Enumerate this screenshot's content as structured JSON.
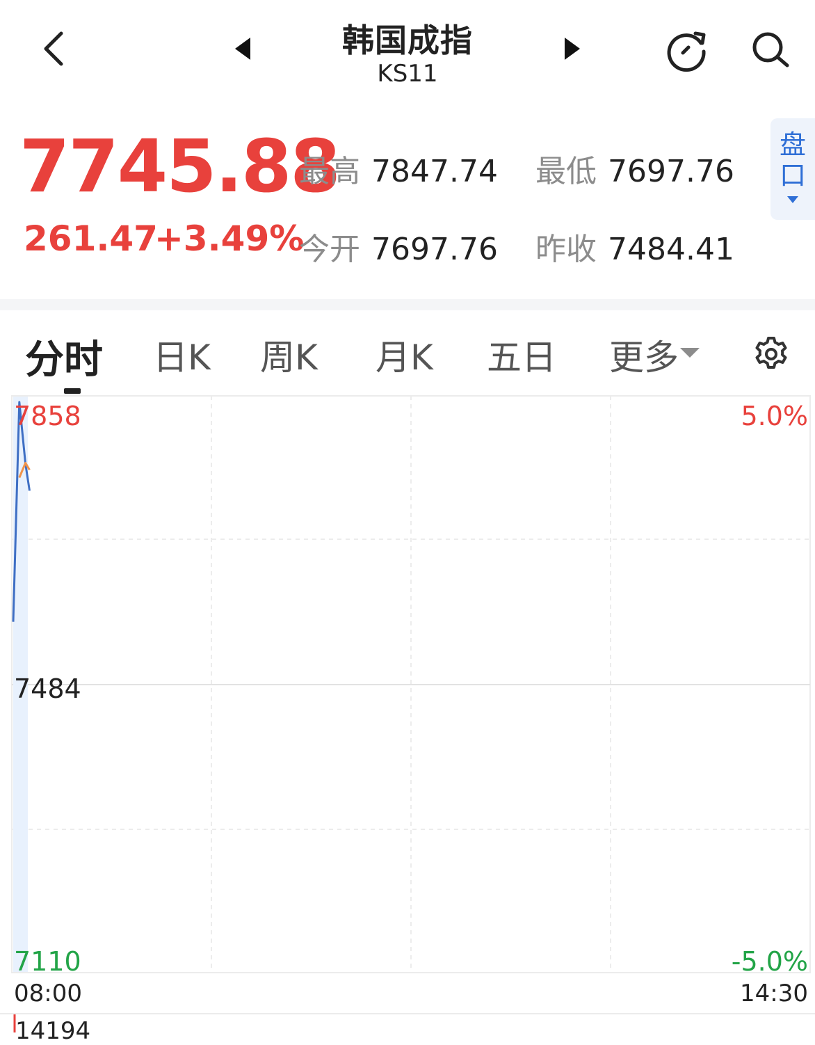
{
  "header": {
    "title": "韩国成指",
    "code": "KS11"
  },
  "quote": {
    "price": "7745.88",
    "change": "261.47",
    "change_pct": "+3.49%",
    "high_label": "最高",
    "high_value": "7847.74",
    "low_label": "最低",
    "low_value": "7697.76",
    "open_label": "今开",
    "open_value": "7697.76",
    "prev_close_label": "昨收",
    "prev_close_value": "7484.41",
    "pankou_label": "盘口"
  },
  "tabs": [
    {
      "label": "分时",
      "active": true
    },
    {
      "label": "日K"
    },
    {
      "label": "周K"
    },
    {
      "label": "月K"
    },
    {
      "label": "五日"
    },
    {
      "label": "更多"
    }
  ],
  "chart": {
    "y_top_label": "7858",
    "y_mid_label": "7484",
    "y_bottom_label": "7110",
    "pct_top_label": "5.0%",
    "pct_bottom_label": "-5.0%",
    "x_start_label": "08:00",
    "x_end_label": "14:30",
    "volume_label": "14194"
  },
  "chart_data": {
    "type": "line",
    "x_range": [
      "08:00",
      "14:30"
    ],
    "ylim": [
      7110,
      7858
    ],
    "y_ticks": [
      7110,
      7484,
      7858
    ],
    "pct_ticks": [
      "-5.0%",
      "5.0%"
    ],
    "grid": true,
    "series": [
      {
        "x": [
          "08:00",
          "08:03",
          "08:06",
          "08:08"
        ],
        "values": [
          7565,
          7850,
          7770,
          7735
        ],
        "color": "#3f6fc4"
      },
      {
        "x": [
          "08:03",
          "08:06",
          "08:08"
        ],
        "values": [
          7752,
          7771,
          7762
        ],
        "color": "#f0934a"
      }
    ]
  },
  "colors": {
    "up": "#e8413c",
    "down": "#22a447",
    "accent": "#2f6fd6",
    "price_line": "#3f6fc4",
    "avg_line": "#f0934a"
  },
  "icons": {
    "back": "chevron-left-icon",
    "prev": "triangle-left-icon",
    "next": "triangle-right-icon",
    "refresh": "refresh-icon",
    "search": "search-icon",
    "settings": "gear-icon"
  }
}
